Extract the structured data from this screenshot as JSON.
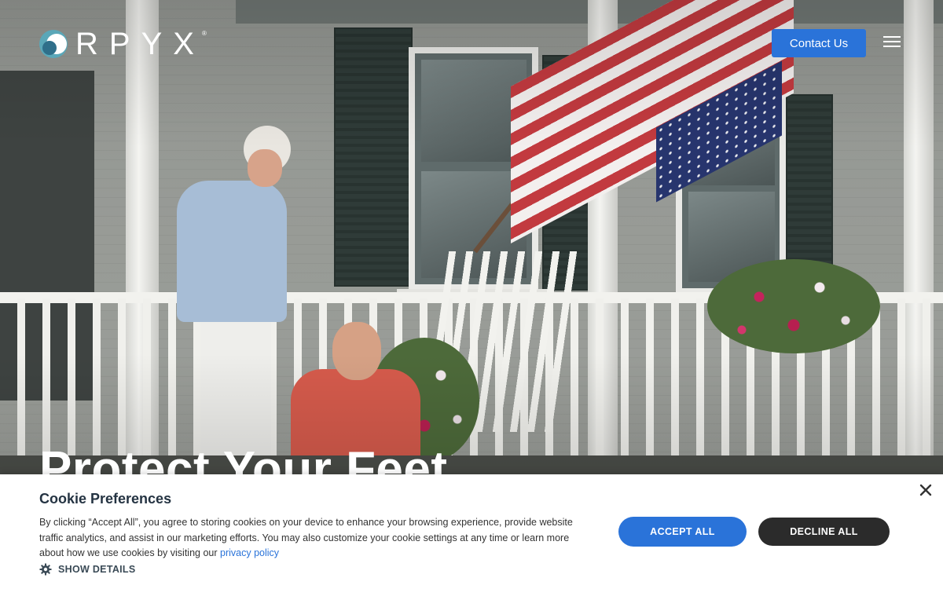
{
  "header": {
    "logo_text": "RPYX",
    "logo_reg": "®",
    "contact_label": "Contact Us"
  },
  "hero": {
    "headline": "Protect Your Feet"
  },
  "cookie_banner": {
    "title": "Cookie Preferences",
    "body_text": "By clicking “Accept All”, you agree to storing cookies on your device to enhance your browsing experience, provide website traffic analytics, and assist in our marketing efforts. You may also customize your cookie settings at any time or learn more about how we use cookies by visiting our ",
    "link_text": "privacy policy",
    "show_details_label": "SHOW DETAILS",
    "accept_label": "ACCEPT ALL",
    "decline_label": "DECLINE ALL"
  },
  "icons": {
    "menu": "hamburger-menu-icon",
    "close": "close-icon",
    "details": "gear-icon",
    "logo": "orpyx-logo-mark"
  },
  "colors": {
    "primary_button": "#2a73d9",
    "decline_button": "#2b2b2b",
    "banner_title": "#243342"
  }
}
